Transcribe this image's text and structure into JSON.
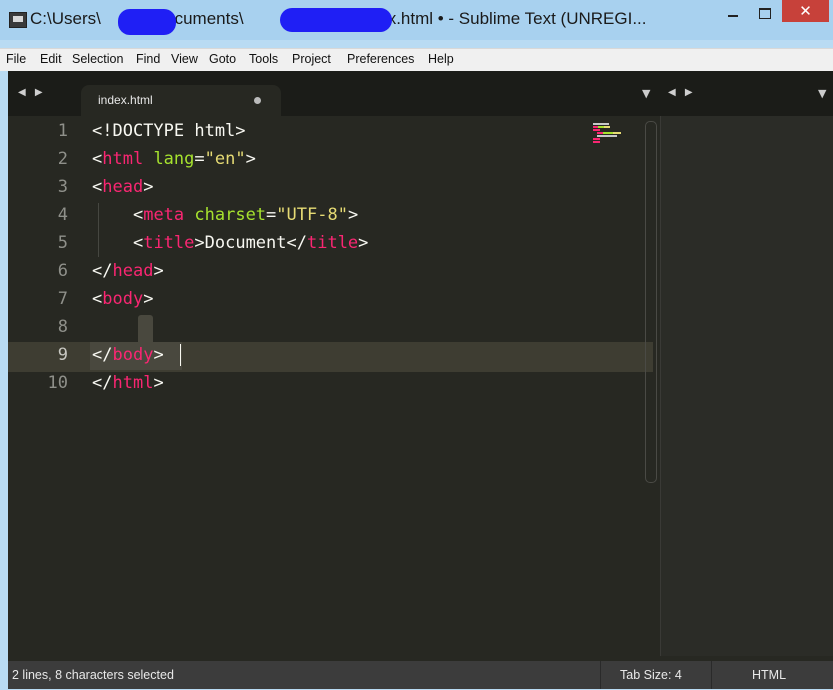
{
  "window": {
    "title_prefix": "C:\\Users\\",
    "title_mid": "Documents\\",
    "title_suffix": "index.html • - Sublime Text (UNREGI...",
    "close_glyph": "✕"
  },
  "menu": [
    "File",
    "Edit",
    "Selection",
    "Find",
    "View",
    "Goto",
    "Tools",
    "Project",
    "Preferences",
    "Help"
  ],
  "tabs": {
    "left_arrows": "◀ ▶",
    "active_tab": "index.html",
    "dropdown_glyph": "▼",
    "right_arrows": "◀ ▶",
    "right_dropdown_glyph": "▼"
  },
  "editor": {
    "line_numbers": [
      "1",
      "2",
      "3",
      "4",
      "5",
      "6",
      "7",
      "8",
      "9",
      "10"
    ],
    "code": {
      "l1": "<!DOCTYPE html>",
      "l2_open": "<",
      "l2_tag": "html",
      "l2_attr": " lang",
      "l2_eq": "=",
      "l2_val": "\"en\"",
      "l2_close": ">",
      "l3_open": "<",
      "l3_tag": "head",
      "l3_close": ">",
      "l4_indent": "    ",
      "l4_open": "<",
      "l4_tag": "meta",
      "l4_attr": " charset",
      "l4_eq": "=",
      "l4_val": "\"UTF-8\"",
      "l4_close": ">",
      "l5_indent": "    ",
      "l5_open": "<",
      "l5_tag": "title",
      "l5_mid": ">Document</",
      "l5_tag2": "title",
      "l5_close": ">",
      "l6_open": "</",
      "l6_tag": "head",
      "l6_close": ">",
      "l7_open": "<",
      "l7_tag": "body",
      "l7_close": ">",
      "l9_open": "</",
      "l9_tag": "body",
      "l9_close": ">",
      "l10_open": "</",
      "l10_tag": "html",
      "l10_close": ">"
    }
  },
  "status": {
    "message": "2 lines, 8 characters selected",
    "tab_size": "Tab Size: 4",
    "syntax": "HTML"
  },
  "colors": {
    "editor_bg": "#272822",
    "tag": "#f92672",
    "attribute": "#a6e22e",
    "string": "#e6db74",
    "text": "#f8f8f2",
    "close_button": "#c7413a"
  }
}
